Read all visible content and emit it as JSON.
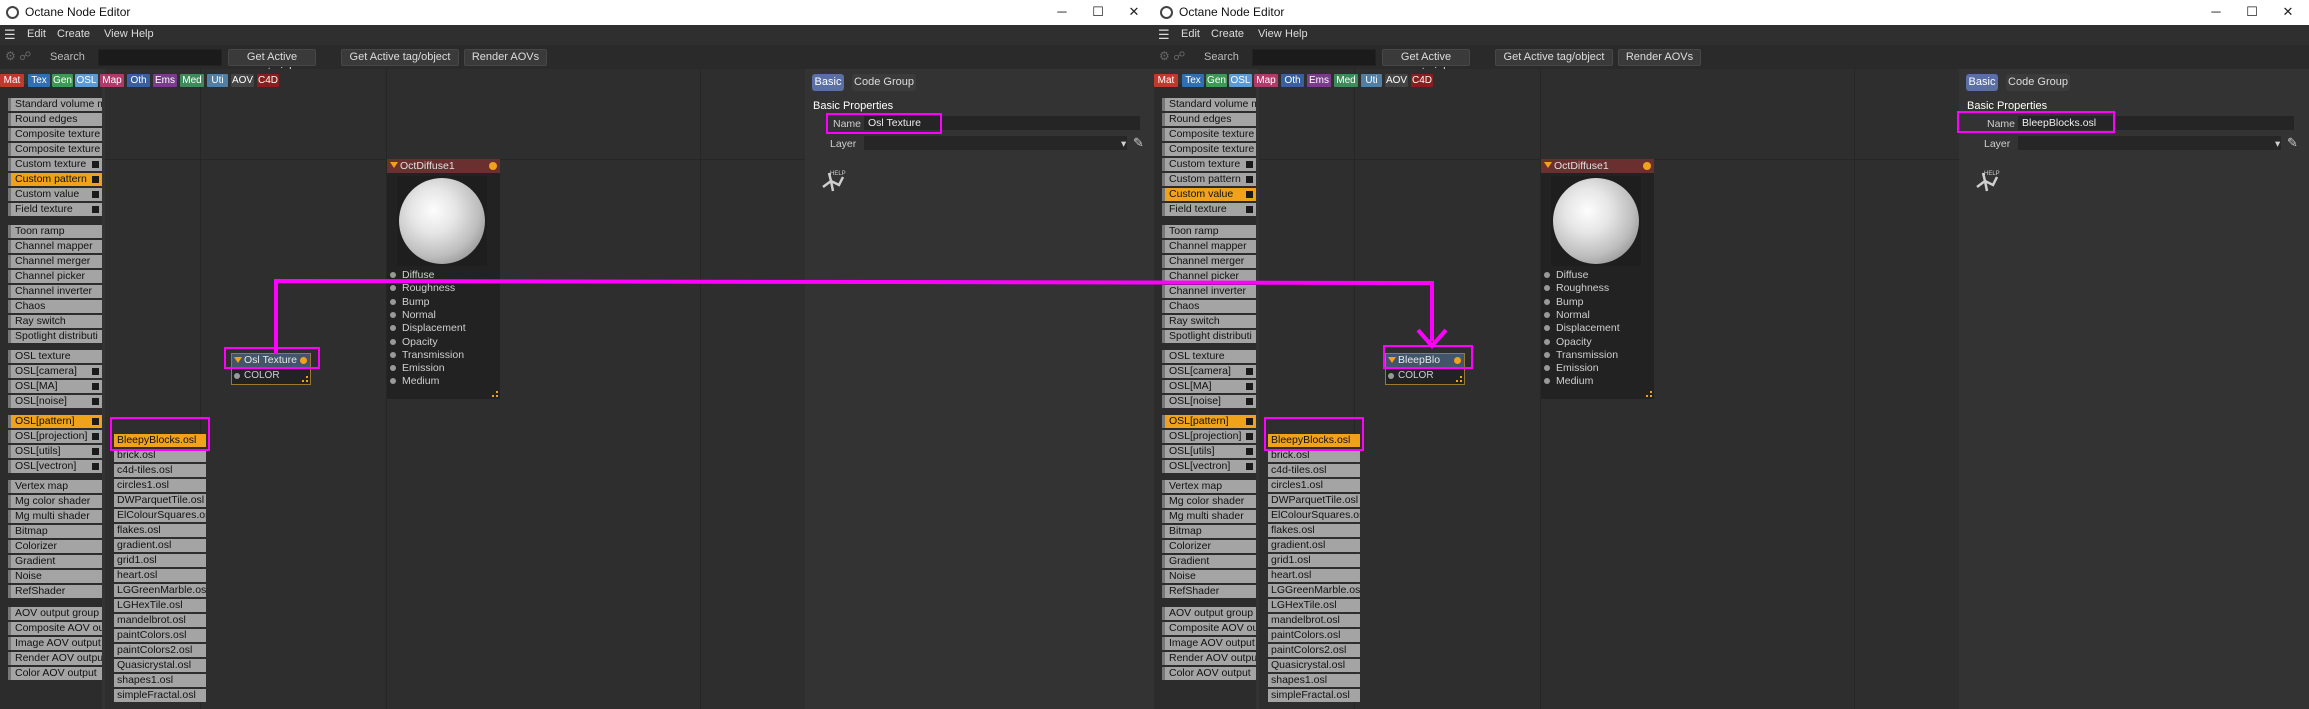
{
  "app": {
    "title": "Octane Node Editor"
  },
  "window_controls": {
    "minimize": "─",
    "maximize": "☐",
    "close": "✕"
  },
  "menu": [
    "Edit",
    "Create",
    "View",
    "Help"
  ],
  "toolbar": {
    "search_label": "Search",
    "buttons": [
      "Get Active material",
      "Get Active tag/object",
      "Render AOVs"
    ]
  },
  "categories": [
    {
      "label": "Mat",
      "color": "#c0392b"
    },
    {
      "label": "Tex",
      "color": "#2f6fb3"
    },
    {
      "label": "Gen",
      "color": "#3b9a55"
    },
    {
      "label": "OSL",
      "color": "#5a9bd5"
    },
    {
      "label": "Map",
      "color": "#b03a6a"
    },
    {
      "label": "Oth",
      "color": "#3a5fa0"
    },
    {
      "label": "Ems",
      "color": "#7a3b8c"
    },
    {
      "label": "Med",
      "color": "#3f8a5a"
    },
    {
      "label": "Uti",
      "color": "#4f7fa5"
    },
    {
      "label": "AOV",
      "color": "#444444"
    },
    {
      "label": "C4D",
      "color": "#8a1e1e"
    }
  ],
  "left": {
    "palette": [
      {
        "label": "Standard volume m"
      },
      {
        "label": "Round edges"
      },
      {
        "label": "Composite texture"
      },
      {
        "label": "Composite texture"
      },
      {
        "label": "Custom texture",
        "sq": true
      },
      {
        "label": "Custom pattern",
        "sq": true,
        "sel": true
      },
      {
        "label": "Custom value",
        "sq": true
      },
      {
        "label": "Field texture",
        "sq": true
      },
      {
        "label": "Toon ramp"
      },
      {
        "label": "Channel mapper"
      },
      {
        "label": "Channel merger"
      },
      {
        "label": "Channel picker"
      },
      {
        "label": "Channel inverter"
      },
      {
        "label": "Chaos"
      },
      {
        "label": "Ray switch"
      },
      {
        "label": "Spotlight distributi"
      },
      {
        "label": "OSL texture"
      },
      {
        "label": "OSL[camera]",
        "sq": true
      },
      {
        "label": "OSL[MA]",
        "sq": true
      },
      {
        "label": "OSL[noise]",
        "sq": true
      },
      {
        "label": "OSL[pattern]",
        "sq": true,
        "sel": true
      },
      {
        "label": "OSL[projection]",
        "sq": true
      },
      {
        "label": "OSL[utils]",
        "sq": true
      },
      {
        "label": "OSL[vectron]",
        "sq": true
      },
      {
        "label": "Vertex map"
      },
      {
        "label": "Mg color shader"
      },
      {
        "label": "Mg multi shader"
      },
      {
        "label": "Bitmap"
      },
      {
        "label": "Colorizer"
      },
      {
        "label": "Gradient"
      },
      {
        "label": "Noise"
      },
      {
        "label": "RefShader"
      },
      {
        "label": "AOV output group"
      },
      {
        "label": "Composite AOV ou"
      },
      {
        "label": "Image AOV output"
      },
      {
        "label": "Render AOV outpu"
      },
      {
        "label": "Color AOV output"
      }
    ],
    "osl_files": [
      "BleepyBlocks.osl",
      "brick.osl",
      "c4d-tiles.osl",
      "circles1.osl",
      "DWParquetTile.osl",
      "ElColourSquares.osl",
      "flakes.osl",
      "gradient.osl",
      "grid1.osl",
      "heart.osl",
      "LGGreenMarble.osl",
      "LGHexTile.osl",
      "mandelbrot.osl",
      "paintColors.osl",
      "paintColors2.osl",
      "Quasicrystal.osl",
      "shapes1.osl",
      "simpleFractal.osl"
    ],
    "shader_node": {
      "title": "Osl Texture",
      "port": "COLOR"
    },
    "props": {
      "name_value": "Osl Texture"
    }
  },
  "right": {
    "palette": [
      {
        "label": "Standard volume m"
      },
      {
        "label": "Round edges"
      },
      {
        "label": "Composite texture"
      },
      {
        "label": "Composite texture"
      },
      {
        "label": "Custom texture",
        "sq": true
      },
      {
        "label": "Custom pattern",
        "sq": true
      },
      {
        "label": "Custom value",
        "sq": true,
        "sel": true
      },
      {
        "label": "Field texture",
        "sq": true
      },
      {
        "label": "Toon ramp"
      },
      {
        "label": "Channel mapper"
      },
      {
        "label": "Channel merger"
      },
      {
        "label": "Channel picker"
      },
      {
        "label": "Channel inverter"
      },
      {
        "label": "Chaos"
      },
      {
        "label": "Ray switch"
      },
      {
        "label": "Spotlight distributi"
      },
      {
        "label": "OSL texture"
      },
      {
        "label": "OSL[camera]",
        "sq": true
      },
      {
        "label": "OSL[MA]",
        "sq": true
      },
      {
        "label": "OSL[noise]",
        "sq": true
      },
      {
        "label": "OSL[pattern]",
        "sq": true,
        "sel": true
      },
      {
        "label": "OSL[projection]",
        "sq": true
      },
      {
        "label": "OSL[utils]",
        "sq": true
      },
      {
        "label": "OSL[vectron]",
        "sq": true
      },
      {
        "label": "Vertex map"
      },
      {
        "label": "Mg color shader"
      },
      {
        "label": "Mg multi shader"
      },
      {
        "label": "Bitmap"
      },
      {
        "label": "Colorizer"
      },
      {
        "label": "Gradient"
      },
      {
        "label": "Noise"
      },
      {
        "label": "RefShader"
      },
      {
        "label": "AOV output group"
      },
      {
        "label": "Composite AOV ou"
      },
      {
        "label": "Image AOV output"
      },
      {
        "label": "Render AOV outpu"
      },
      {
        "label": "Color AOV output"
      }
    ],
    "osl_files": [
      "BleepyBlocks.osl",
      "brick.osl",
      "c4d-tiles.osl",
      "circles1.osl",
      "DWParquetTile.osl",
      "ElColourSquares.osl",
      "flakes.osl",
      "gradient.osl",
      "grid1.osl",
      "heart.osl",
      "LGGreenMarble.osl",
      "LGHexTile.osl",
      "mandelbrot.osl",
      "paintColors.osl",
      "paintColors2.osl",
      "Quasicrystal.osl",
      "shapes1.osl",
      "simpleFractal.osl"
    ],
    "shader_node": {
      "title": "BleepBlo",
      "port": "COLOR"
    },
    "props": {
      "name_value": "BleepBlocks.osl"
    }
  },
  "material_node": {
    "title": "OctDiffuse1",
    "ports": [
      "Diffuse",
      "Roughness",
      "Bump",
      "Normal",
      "Displacement",
      "Opacity",
      "Transmission",
      "Emission",
      "Medium"
    ]
  },
  "props_panel": {
    "tabs": [
      "Basic",
      "Code Group"
    ],
    "section_title": "Basic Properties",
    "name_label": "Name",
    "layer_label": "Layer",
    "help_label": "HELP"
  },
  "colors": {
    "highlight": "#ff00ff",
    "selected_item": "#f0a31a",
    "active_tab": "#5a6fa3",
    "material_header": "#6a3030",
    "shader_header": "#44546c"
  }
}
